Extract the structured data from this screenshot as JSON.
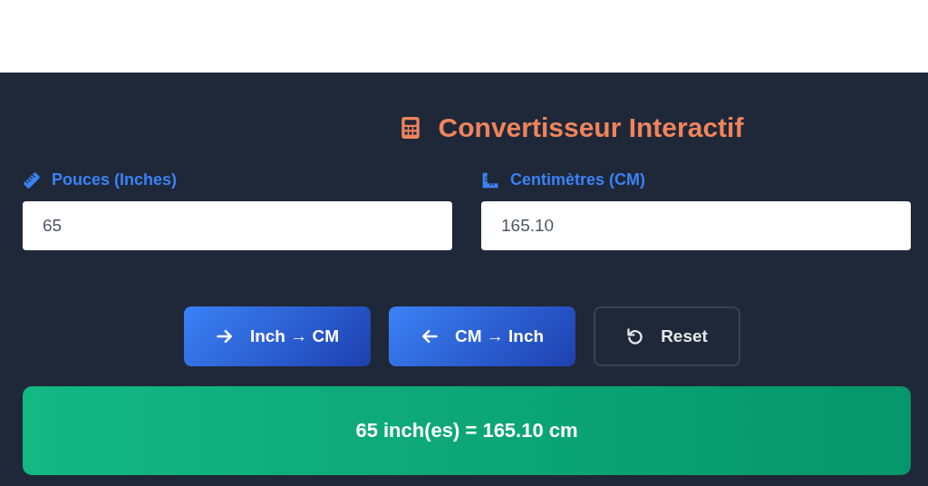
{
  "title": "Convertisseur Interactif",
  "fields": [
    {
      "label": "Pouces (Inches)",
      "kind": "ruler",
      "value": "65"
    },
    {
      "label": "Centimètres (CM)",
      "kind": "square",
      "value": "165.10"
    }
  ],
  "buttons": [
    {
      "label": "Inch → CM",
      "kind": "forward"
    },
    {
      "label": "CM → Inch",
      "kind": "back"
    },
    {
      "label": "Reset",
      "kind": "reset"
    }
  ],
  "result": "65 inch(es) = 165.10 cm"
}
